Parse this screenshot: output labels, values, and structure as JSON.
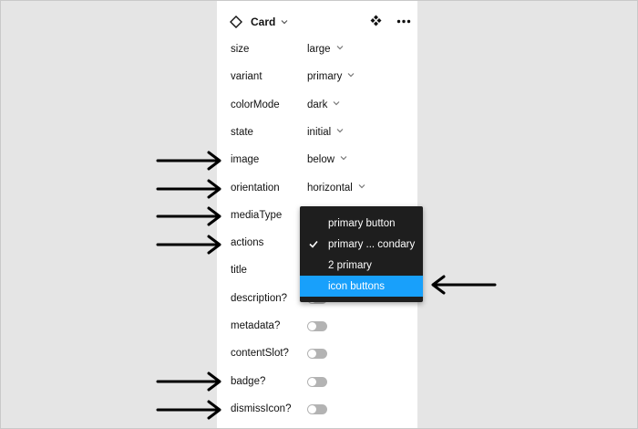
{
  "component": {
    "name": "Card",
    "icon": "component-icon",
    "actions": [
      "variant-icon",
      "more-icon"
    ]
  },
  "properties": [
    {
      "label": "size",
      "type": "select",
      "value": "large"
    },
    {
      "label": "variant",
      "type": "select",
      "value": "primary"
    },
    {
      "label": "colorMode",
      "type": "select",
      "value": "dark"
    },
    {
      "label": "state",
      "type": "select",
      "value": "initial"
    },
    {
      "label": "image",
      "type": "select",
      "value": "below"
    },
    {
      "label": "orientation",
      "type": "select",
      "value": "horizontal"
    },
    {
      "label": "mediaType",
      "type": "select",
      "value": ""
    },
    {
      "label": "actions",
      "type": "select",
      "value": ""
    },
    {
      "label": "title",
      "type": "text",
      "value": ""
    },
    {
      "label": "description?",
      "type": "toggle",
      "value": ""
    },
    {
      "label": "metadata?",
      "type": "toggle",
      "value": ""
    },
    {
      "label": "contentSlot?",
      "type": "toggle",
      "value": ""
    },
    {
      "label": "badge?",
      "type": "toggle",
      "value": ""
    },
    {
      "label": "dismissIcon?",
      "type": "toggle",
      "value": ""
    }
  ],
  "dropdown": {
    "items": [
      {
        "label": "primary button",
        "checked": false,
        "highlighted": false
      },
      {
        "label": "primary ... condary",
        "checked": true,
        "highlighted": false
      },
      {
        "label": "2 primary",
        "checked": false,
        "highlighted": false
      },
      {
        "label": "icon buttons",
        "checked": false,
        "highlighted": true
      }
    ]
  },
  "colors": {
    "canvas": "#e5e5e5",
    "panel": "#ffffff",
    "menu_bg": "#1e1e1e",
    "menu_highlight": "#18a0fb",
    "toggle_off": "#b3b3b3",
    "annotation_arrow": "#000000"
  },
  "annotations": {
    "arrows_pointing_at": [
      "image",
      "orientation",
      "mediaType",
      "actions",
      "badge?",
      "dismissIcon?",
      "icon buttons"
    ]
  }
}
